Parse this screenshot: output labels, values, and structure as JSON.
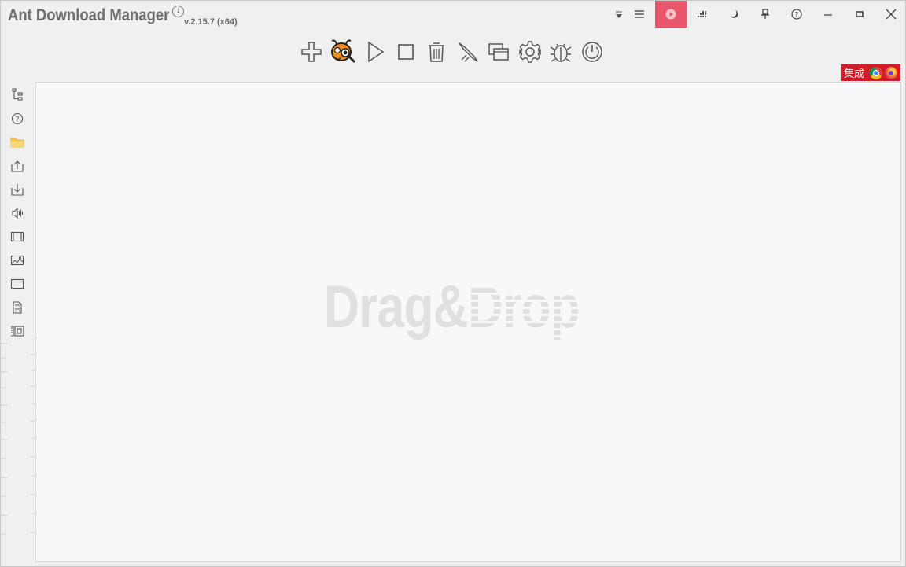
{
  "app": {
    "title": "Ant Download Manager",
    "version": "v.2.15.7 (x64)"
  },
  "window_controls": [
    {
      "name": "dropdown-arrow-icon",
      "label": "dropdown"
    },
    {
      "name": "menu-icon",
      "label": "menu"
    },
    {
      "name": "start-queue-icon",
      "label": "start"
    },
    {
      "name": "speed-limit-icon",
      "label": "speed"
    },
    {
      "name": "night-mode-icon",
      "label": "night mode"
    },
    {
      "name": "pin-icon",
      "label": "pin"
    },
    {
      "name": "help-icon",
      "label": "help"
    },
    {
      "name": "minimize-icon",
      "label": "minimize"
    },
    {
      "name": "maximize-icon",
      "label": "maximize"
    },
    {
      "name": "close-icon",
      "label": "close"
    }
  ],
  "toolbar": [
    {
      "name": "add-download-icon"
    },
    {
      "name": "ant-mascot-icon"
    },
    {
      "name": "resume-icon"
    },
    {
      "name": "stop-icon"
    },
    {
      "name": "delete-icon"
    },
    {
      "name": "clean-icon"
    },
    {
      "name": "windows-icon"
    },
    {
      "name": "settings-icon"
    },
    {
      "name": "debug-icon"
    },
    {
      "name": "shutdown-icon"
    }
  ],
  "integration": {
    "label": "集成",
    "browsers": [
      "chrome-icon",
      "firefox-icon"
    ]
  },
  "sidebar": [
    {
      "name": "all-downloads-tree-icon"
    },
    {
      "name": "unknown-icon"
    },
    {
      "name": "folder-icon"
    },
    {
      "name": "uploading-icon"
    },
    {
      "name": "downloaded-icon"
    },
    {
      "name": "audio-icon"
    },
    {
      "name": "video-icon"
    },
    {
      "name": "image-icon"
    },
    {
      "name": "program-icon"
    },
    {
      "name": "document-icon"
    },
    {
      "name": "archive-icon"
    }
  ],
  "main": {
    "placeholder_drag": "Drag&",
    "placeholder_drop": "Drop"
  },
  "colors": {
    "accent_play": "#e9566b",
    "integration_bg": "#cf1e27",
    "background": "#f0f0f0",
    "panel": "#f7f8fa"
  }
}
